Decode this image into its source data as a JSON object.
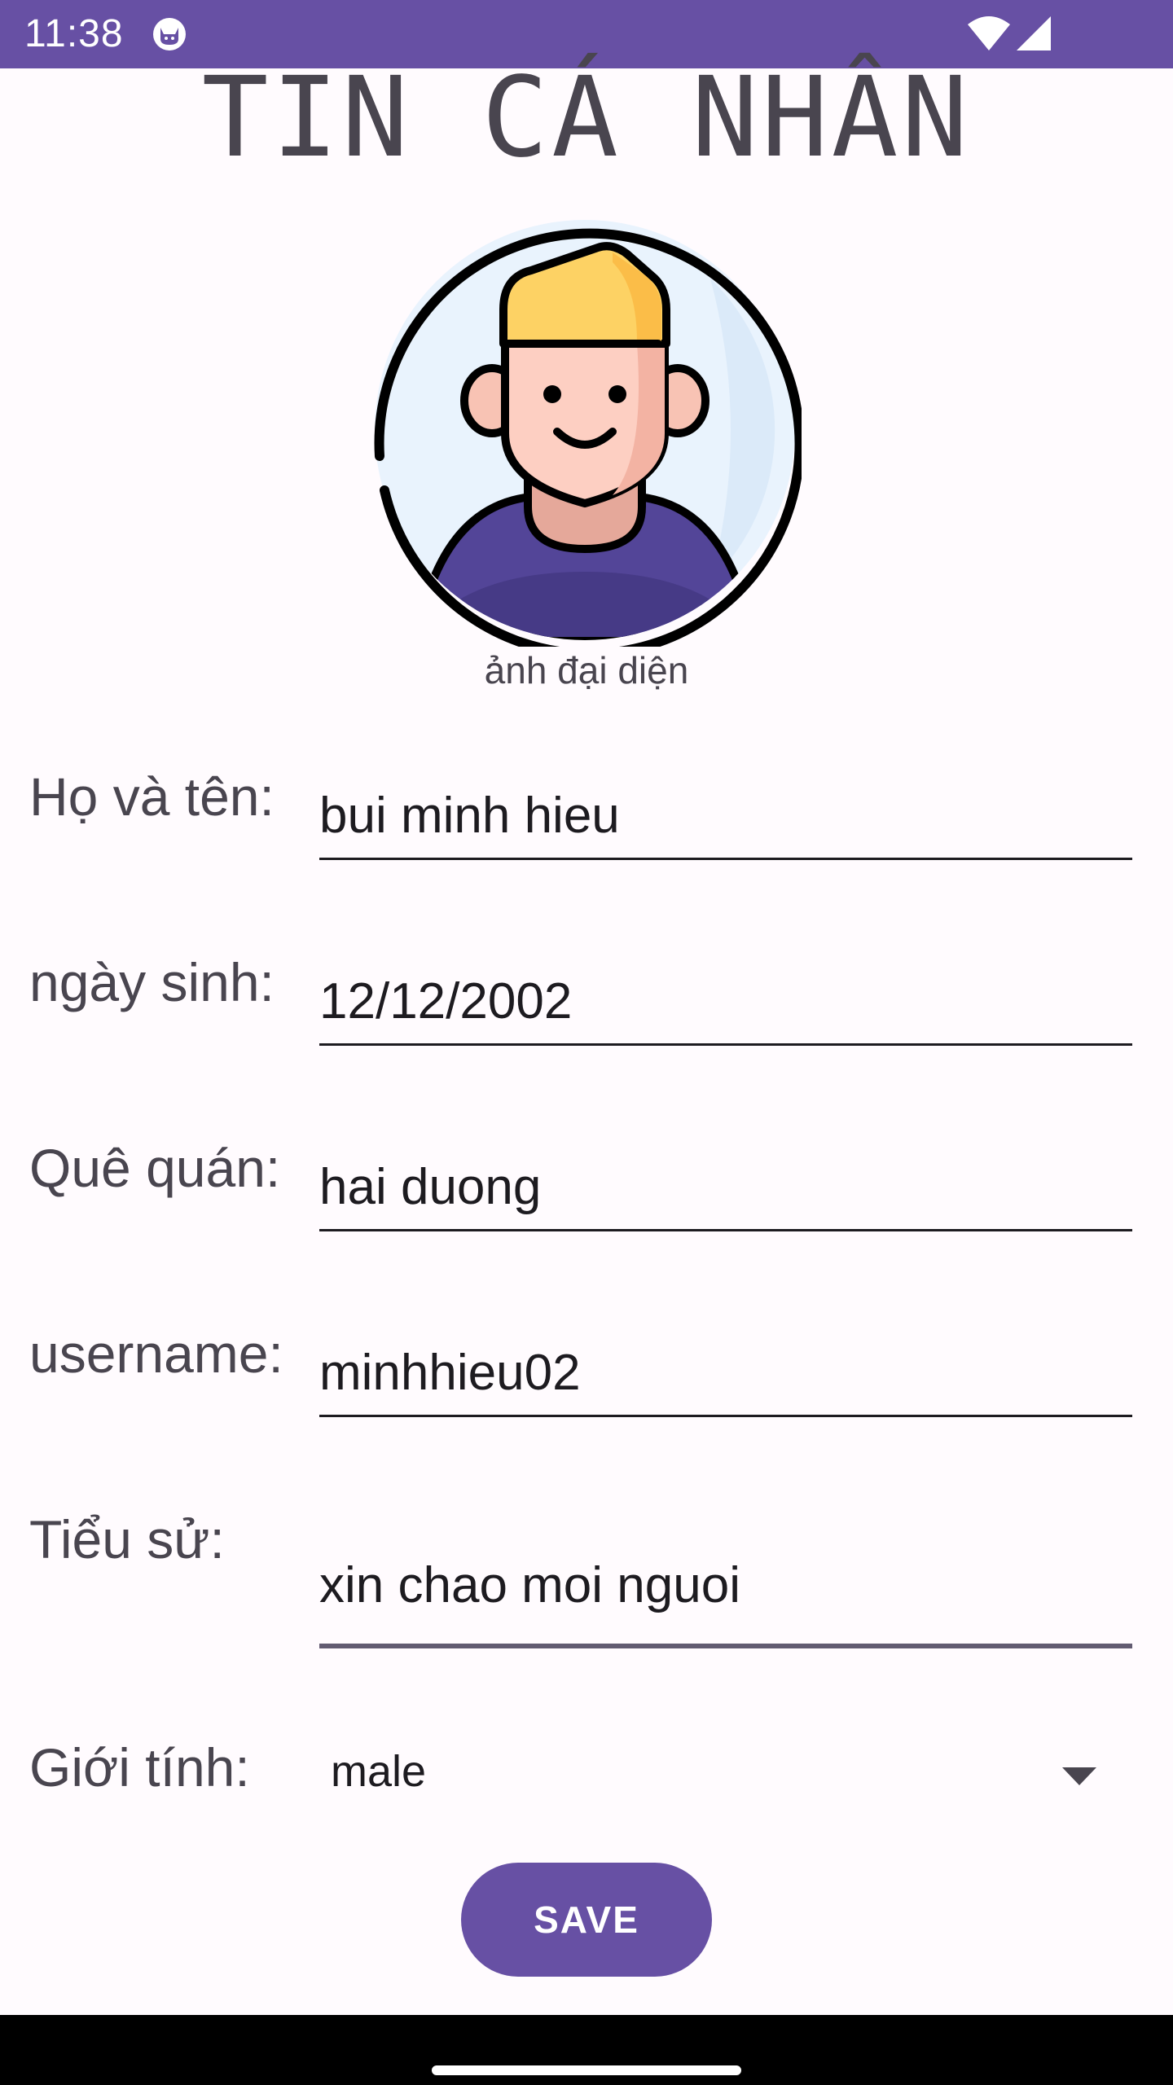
{
  "status_bar": {
    "time": "11:38",
    "icons": [
      "cat-notification-icon",
      "wifi-icon",
      "signal-icon"
    ]
  },
  "title": "TIN CÁ NHÂN",
  "avatar": {
    "caption": "ảnh đại diện",
    "icon": "male-avatar-icon"
  },
  "form": {
    "fullname": {
      "label": "Họ và tên:",
      "value": "bui minh hieu"
    },
    "birthday": {
      "label": "ngày sinh:",
      "value": "12/12/2002"
    },
    "hometown": {
      "label": "Quê quán:",
      "value": "hai duong"
    },
    "username": {
      "label": "username:",
      "value": "minhhieu02"
    },
    "bio": {
      "label": "Tiểu sử:",
      "value": "xin chao moi nguoi"
    },
    "gender": {
      "label": "Giới tính:",
      "selected": "male"
    }
  },
  "save_button": {
    "label": "SAVE"
  },
  "colors": {
    "primary": "#6750a4",
    "background": "#fffbfe",
    "text": "#49454f",
    "input_text": "#1d1b20"
  }
}
